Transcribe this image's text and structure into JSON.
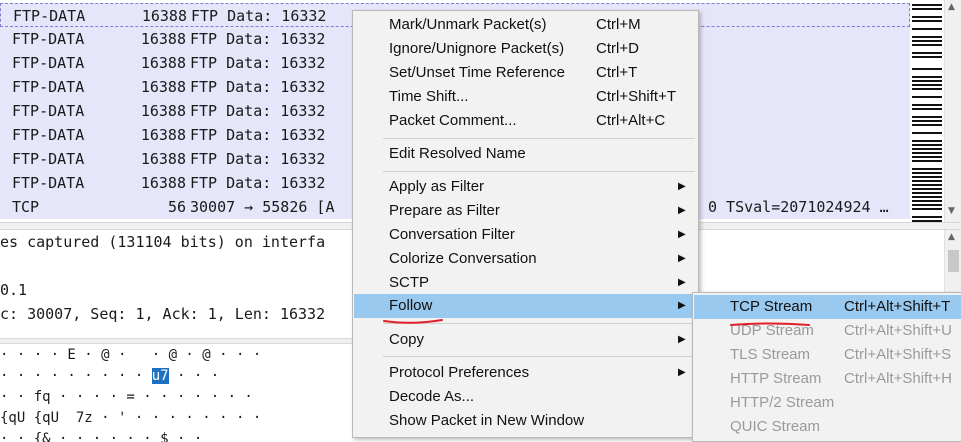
{
  "packet_list": {
    "rows": [
      {
        "proto": "FTP-DATA",
        "len": "16388",
        "info": "FTP Data: 16332",
        "tail": ""
      },
      {
        "proto": "FTP-DATA",
        "len": "16388",
        "info": "FTP Data: 16332",
        "tail": ""
      },
      {
        "proto": "FTP-DATA",
        "len": "16388",
        "info": "FTP Data: 16332",
        "tail": ""
      },
      {
        "proto": "FTP-DATA",
        "len": "16388",
        "info": "FTP Data: 16332",
        "tail": ""
      },
      {
        "proto": "FTP-DATA",
        "len": "16388",
        "info": "FTP Data: 16332",
        "tail": ""
      },
      {
        "proto": "FTP-DATA",
        "len": "16388",
        "info": "FTP Data: 16332",
        "tail": ""
      },
      {
        "proto": "FTP-DATA",
        "len": "16388",
        "info": "FTP Data: 16332",
        "tail": ""
      },
      {
        "proto": "FTP-DATA",
        "len": "16388",
        "info": "FTP Data: 16332",
        "tail": ""
      },
      {
        "proto": "TCP",
        "len": "56",
        "info": "30007 → 55826 [A",
        "tail": "0 TSval=2071024924 …"
      }
    ]
  },
  "details": {
    "lines": [
      "es captured (131104 bits) on interfa",
      "",
      "0.1",
      "c: 30007, Seq: 1, Ack: 1, Len: 16332"
    ]
  },
  "bytes": {
    "lines": [
      {
        "pre": "· · · · E · @ ·   · @ · @ · · ·",
        "hl": "",
        "post": ""
      },
      {
        "pre": "· · · · · · · · · ",
        "hl": "u7",
        "post": " · · ·"
      },
      {
        "pre": "· · fq · · · · = · · · · · · ·",
        "hl": "",
        "post": ""
      },
      {
        "pre": "{qU {qU  7z · ' · · · · · · · ·",
        "hl": "",
        "post": ""
      },
      {
        "pre": "· · {& · · · · · · $ · ·",
        "hl": "",
        "post": ""
      }
    ]
  },
  "context_menu": {
    "items": [
      {
        "label": "Mark/Unmark Packet(s)",
        "shortcut": "Ctrl+M",
        "arrow": ""
      },
      {
        "label": "Ignore/Unignore Packet(s)",
        "shortcut": "Ctrl+D",
        "arrow": ""
      },
      {
        "label": "Set/Unset Time Reference",
        "shortcut": "Ctrl+T",
        "arrow": ""
      },
      {
        "label": "Time Shift...",
        "shortcut": "Ctrl+Shift+T",
        "arrow": ""
      },
      {
        "label": "Packet Comment...",
        "shortcut": "Ctrl+Alt+C",
        "arrow": ""
      },
      {
        "label": "Edit Resolved Name",
        "shortcut": "",
        "arrow": ""
      },
      {
        "label": "Apply as Filter",
        "shortcut": "",
        "arrow": "▶"
      },
      {
        "label": "Prepare as Filter",
        "shortcut": "",
        "arrow": "▶"
      },
      {
        "label": "Conversation Filter",
        "shortcut": "",
        "arrow": "▶"
      },
      {
        "label": "Colorize Conversation",
        "shortcut": "",
        "arrow": "▶"
      },
      {
        "label": "SCTP",
        "shortcut": "",
        "arrow": "▶"
      },
      {
        "label": "Follow",
        "shortcut": "",
        "arrow": "▶"
      },
      {
        "label": "Copy",
        "shortcut": "",
        "arrow": "▶"
      },
      {
        "label": "Protocol Preferences",
        "shortcut": "",
        "arrow": "▶"
      },
      {
        "label": "Decode As...",
        "shortcut": "",
        "arrow": ""
      },
      {
        "label": "Show Packet in New Window",
        "shortcut": "",
        "arrow": ""
      }
    ]
  },
  "follow_submenu": {
    "items": [
      {
        "label": "TCP Stream",
        "shortcut": "Ctrl+Alt+Shift+T",
        "state": "active"
      },
      {
        "label": "UDP Stream",
        "shortcut": "Ctrl+Alt+Shift+U",
        "state": "disabled"
      },
      {
        "label": "TLS Stream",
        "shortcut": "Ctrl+Alt+Shift+S",
        "state": "disabled"
      },
      {
        "label": "HTTP Stream",
        "shortcut": "Ctrl+Alt+Shift+H",
        "state": "disabled"
      },
      {
        "label": "HTTP/2 Stream",
        "shortcut": "",
        "state": "disabled"
      },
      {
        "label": "QUIC Stream",
        "shortcut": "",
        "state": "disabled"
      }
    ]
  },
  "colors": {
    "row_bg": "#e6e6fb",
    "menu_bg": "#f2f2f2",
    "menu_highlight": "#99c9ef",
    "annotation_red": "#e0202a",
    "byte_highlight": "#1f6fc2"
  }
}
